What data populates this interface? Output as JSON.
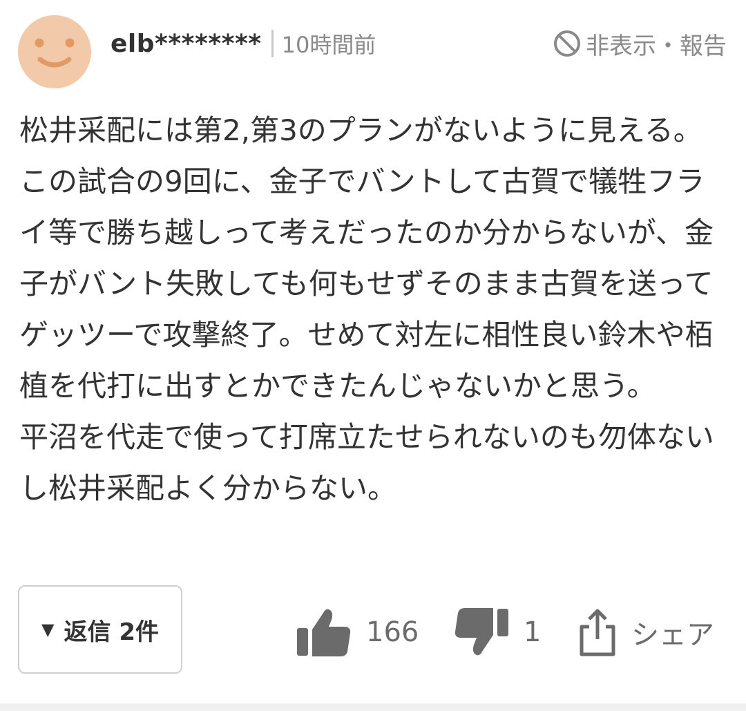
{
  "comment": {
    "username": "elb********",
    "time": "10時間前",
    "report_label": "非表示・報告",
    "body": "松井采配には第2,第3のプランがないように見える。この試合の9回に、金子でバントして古賀で犠牲フライ等で勝ち越しって考えだったのか分からないが、金子がバント失敗しても何もせずそのまま古賀を送ってゲッツーで攻撃終了。せめて対左に相性良い鈴木や栢植を代打に出すとかできたんじゃないかと思う。\n平沼を代走で使って打席立たせられないのも勿体ないし松井采配よく分からない。",
    "replies": {
      "arrow": "▼",
      "label": "返信 2件"
    },
    "likes": "166",
    "dislikes": "1",
    "share_label": "シェア",
    "icons": {
      "avatar": "smiley-face-icon",
      "report": "prohibited-icon",
      "like": "thumbs-up-icon",
      "dislike": "thumbs-down-icon",
      "share": "share-icon"
    },
    "colors": {
      "avatar_bg": "#F2C9A9",
      "avatar_face": "#E39A62",
      "icon_gray": "#6b6b6b"
    }
  }
}
